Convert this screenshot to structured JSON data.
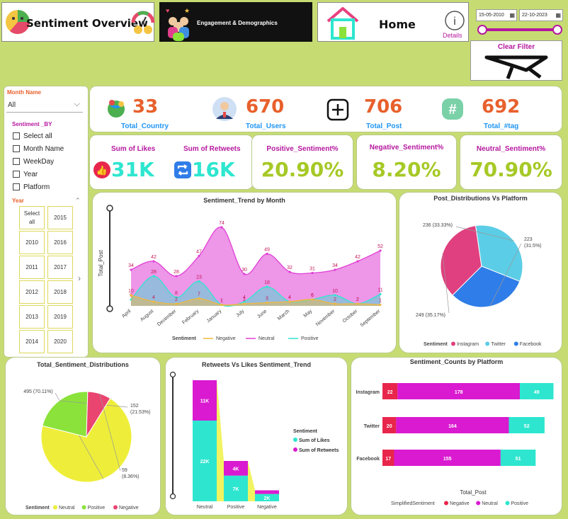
{
  "nav": {
    "sentiment_overview": "Sentiment Overview",
    "engagement": "Engagement & Demographics",
    "home": "Home",
    "details": "Details",
    "date_start": "15-05-2010",
    "date_end": "22-10-2023",
    "clear_filter": "Clear Filter"
  },
  "filters": {
    "month_name_label": "Month Name",
    "month_name_value": "All",
    "sentiment_by_label": "Sentiment _BY",
    "options": [
      "Select all",
      "Month Name",
      "WeekDay",
      "Year",
      "Platform"
    ],
    "year_label": "Year",
    "years": [
      "Select all",
      "2015",
      "2010",
      "2016",
      "2011",
      "2017",
      "2012",
      "2018",
      "2013",
      "2019",
      "2014",
      "2020"
    ]
  },
  "kpis": {
    "country_value": "33",
    "country_label": "Total_Country",
    "users_value": "670",
    "users_label": "Total_Users",
    "post_value": "706",
    "post_label": "Total_Post",
    "tag_value": "692",
    "tag_label": "Total_#tag"
  },
  "engagement": {
    "likes_label": "Sum of Likes",
    "likes_value": "31K",
    "retweets_label": "Sum of Retweets",
    "retweets_value": "16K"
  },
  "sentiment_pct": {
    "positive_label": "Positive_Sentiment%",
    "positive_value": "20.90%",
    "negative_label": "Negative_Sentiment%",
    "negative_value": "8.20%",
    "neutral_label": "Neutral_Sentiment%",
    "neutral_value": "70.90%"
  },
  "colors": {
    "negative": "#f0b93b",
    "neutral": "#e03fd6",
    "positive": "#2ee6cf",
    "instagram": "#e0407f",
    "twitter": "#5ccde6",
    "facebook": "#2f7de8",
    "pie_neutral": "#eeee3a",
    "pie_positive": "#8ae23a",
    "pie_negative": "#ea4470",
    "bar_negative": "#e8264c",
    "bar_neutral": "#d91ad0",
    "bar_positive": "#2ee6cf"
  },
  "chart_data": [
    {
      "type": "area",
      "title": "Sentiment_Trend by Month",
      "ylabel": "Total_Post",
      "xlabel": "",
      "categories": [
        "April",
        "August",
        "December",
        "February",
        "January",
        "July",
        "June",
        "March",
        "May",
        "November",
        "October",
        "September"
      ],
      "series": [
        {
          "name": "Negative",
          "values": [
            10,
            4,
            2,
            7,
            1,
            2,
            3,
            4,
            6,
            2,
            2,
            1
          ]
        },
        {
          "name": "Neutral",
          "values": [
            34,
            42,
            28,
            47,
            74,
            30,
            49,
            32,
            31,
            34,
            42,
            52
          ]
        },
        {
          "name": "Positive",
          "values": [
            6,
            28,
            8,
            23,
            1,
            4,
            18,
            4,
            6,
            10,
            2,
            11
          ]
        }
      ],
      "legend_title": "Sentiment",
      "legend": "bottom",
      "ylim": [
        0,
        80
      ]
    },
    {
      "type": "pie",
      "title": "Post_Distributions Vs Platform",
      "slices": [
        {
          "name": "Instagram",
          "value": 249,
          "label": "249 (35.17%)"
        },
        {
          "name": "Twitter",
          "value": 236,
          "label": "236 (33.33%)"
        },
        {
          "name": "Facebook",
          "value": 223,
          "label": "223 (31.5%)"
        }
      ],
      "legend_title": "Sentiment",
      "legend": "bottom"
    },
    {
      "type": "pie",
      "title": "Total_Sentiment_Distributions",
      "slices": [
        {
          "name": "Neutral",
          "value": 495,
          "label": "495 (70.11%)"
        },
        {
          "name": "Positive",
          "value": 152,
          "label": "152 (21.53%)"
        },
        {
          "name": "Negative",
          "value": 59,
          "label": "59 (8.36%)"
        }
      ],
      "legend_title": "Sentiment",
      "legend": "bottom"
    },
    {
      "type": "bar",
      "title": "Retweets Vs Likes Sentiment_Trend",
      "categories": [
        "Neutral",
        "Positive",
        "Negative"
      ],
      "series": [
        {
          "name": "Sum of Likes",
          "values": [
            22,
            7,
            2
          ],
          "labels": [
            "22K",
            "7K",
            "2K"
          ]
        },
        {
          "name": "Sum of Retweets",
          "values": [
            11,
            4,
            1
          ],
          "labels": [
            "11K",
            "4K",
            ""
          ]
        }
      ],
      "legend_title": "Sentiment",
      "legend": "right"
    },
    {
      "type": "bar",
      "title": "Sentiment_Counts by Platform",
      "xlabel": "Total_Post",
      "categories": [
        "Instagram",
        "Twitter",
        "Facebook"
      ],
      "series": [
        {
          "name": "Negative",
          "values": [
            22,
            20,
            17
          ]
        },
        {
          "name": "Neutral",
          "values": [
            178,
            164,
            155
          ]
        },
        {
          "name": "Positive",
          "values": [
            49,
            52,
            51
          ]
        }
      ],
      "legend_title": "SimplifiedSentiment",
      "legend": "bottom"
    }
  ]
}
